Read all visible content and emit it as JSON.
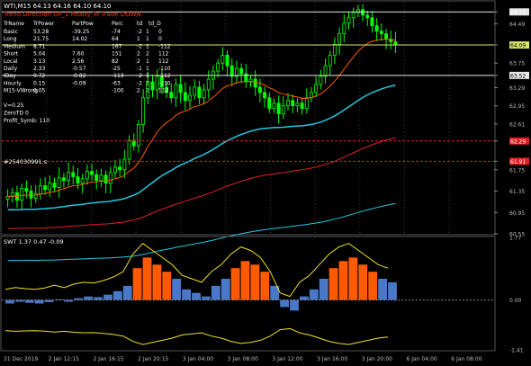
{
  "header": {
    "symbol_line": "WTI,M15  64.13 64.16 64.10 64.10",
    "trend_line": "Trend Direction  UP_1  Ready To Trade  DOWN",
    "trend_color": "#ff3300"
  },
  "stats": {
    "headers": [
      "TrName",
      "TrPower",
      "PartPow",
      "Perc",
      "td",
      "td_D"
    ],
    "rows": [
      [
        "Basic",
        "53.28",
        "-39.25",
        "-74",
        "-2",
        "1",
        "0"
      ],
      [
        "Long",
        "21.75",
        "14.02",
        "64",
        "1",
        "1",
        "0"
      ],
      [
        "Medium",
        "8.71",
        "",
        "167",
        "-2",
        "1",
        "-112"
      ],
      [
        "Short",
        "5.04",
        "7.60",
        "151",
        "2",
        "2",
        "112"
      ],
      [
        "Local",
        "3.13",
        "2.56",
        "82",
        "2",
        "1",
        "112"
      ],
      [
        "Daily",
        "2.33",
        "-0.57",
        "-25",
        "-1",
        "1",
        "-110"
      ],
      [
        "IDay",
        "0.72",
        "-0.82",
        "-113",
        "-2",
        "1",
        "-112"
      ],
      [
        "Hourly",
        "0.15",
        "-0.09",
        "-63",
        "-2",
        "1",
        "-110"
      ],
      [
        "M15-VWrong",
        "0.05",
        "",
        "-100",
        "2",
        "2",
        "112"
      ]
    ],
    "extra": [
      "V=0.25",
      "ZeroTD    0",
      "Profit_Symb: 110"
    ]
  },
  "level_label": "#254030991.s",
  "sub_label": "SWT 1.37 0.47 -0.09",
  "colors": {
    "up_candle": "#00ff00",
    "down_candle": "#00ff00",
    "cyan": "#22c8e0",
    "yellow": "#f0e020",
    "orange": "#ff5a00",
    "blue": "#4a78c8",
    "red": "#e02020",
    "grid": "#3a3a3a"
  },
  "chart_data": [
    {
      "type": "candlestick",
      "title": "WTI,M15",
      "ylim": [
        60.55,
        64.9
      ],
      "yticks": [
        "64.71",
        "64.49",
        "64.09",
        "63.75",
        "63.52",
        "63.29",
        "62.95",
        "62.61",
        "62.29",
        "61.91",
        "61.75",
        "61.35",
        "60.95",
        "60.55"
      ],
      "highlighted_levels": [
        {
          "value": "64.71",
          "color": "#ffffff",
          "bg": "#e6e6e6"
        },
        {
          "value": "64.09",
          "color": "#000000",
          "bg": "#d7e66d"
        },
        {
          "value": "63.52",
          "color": "#000000",
          "bg": "#e6e6e6"
        },
        {
          "value": "62.29",
          "color": "#ffffff",
          "bg": "#e02020"
        },
        {
          "value": "61.91",
          "color": "#ffffff",
          "bg": "#e02020"
        }
      ],
      "xticks": [
        "31 Dec 2019",
        "2 Jan 12:15",
        "2 Jan 16:15",
        "2 Jan 20:15",
        "3 Jan 04:00",
        "3 Jan 08:00",
        "3 Jan 12:00",
        "3 Jan 16:00",
        "3 Jan 20:00",
        "6 Jan 04:00",
        "6 Jan 08:00"
      ],
      "close": [
        61.25,
        61.32,
        61.18,
        61.4,
        61.35,
        61.22,
        61.3,
        61.45,
        61.38,
        61.5,
        61.42,
        61.6,
        61.55,
        61.7,
        61.62,
        61.5,
        61.58,
        61.72,
        61.66,
        61.55,
        61.65,
        61.5,
        61.7,
        61.8,
        61.75,
        61.95,
        62.3,
        62.2,
        62.6,
        63.1,
        63.4,
        63.25,
        63.5,
        63.3,
        63.2,
        63.1,
        63.35,
        63.2,
        63.05,
        63.15,
        63.3,
        63.1,
        63.25,
        63.45,
        63.6,
        63.75,
        63.9,
        63.7,
        63.5,
        63.65,
        63.55,
        63.4,
        63.45,
        63.3,
        63.2,
        63.1,
        62.9,
        63.0,
        62.8,
        62.95,
        63.05,
        62.95,
        63.0,
        62.9,
        63.1,
        63.2,
        63.35,
        63.5,
        63.7,
        63.9,
        64.1,
        64.3,
        64.5,
        64.6,
        64.7,
        64.75,
        64.65,
        64.6,
        64.45,
        64.35,
        64.3,
        64.2,
        64.15,
        64.1
      ],
      "lines": [
        "cyan MA",
        "orange MA",
        "red MA",
        "cyan bands"
      ]
    },
    {
      "type": "area",
      "title": "SWT",
      "values_label": "SWT 1.37 0.47 -0.09",
      "ylim": [
        -1.41,
        1.77
      ],
      "yticks": [
        "1.77",
        "0.00",
        "-1.41"
      ],
      "series": [
        {
          "name": "SWT",
          "values": [
            -0.1,
            -0.05,
            -0.08,
            -0.1,
            -0.06,
            0.02,
            -0.05,
            0.05,
            0.1,
            0.08,
            0.15,
            0.25,
            0.4,
            0.9,
            1.2,
            1.0,
            0.8,
            0.6,
            0.3,
            0.2,
            0.1,
            0.4,
            0.6,
            0.9,
            1.1,
            1.0,
            0.8,
            0.4,
            -0.2,
            -0.3,
            0.1,
            0.3,
            0.6,
            0.9,
            1.1,
            1.2,
            1.0,
            0.8,
            0.6,
            0.5
          ]
        }
      ]
    }
  ]
}
